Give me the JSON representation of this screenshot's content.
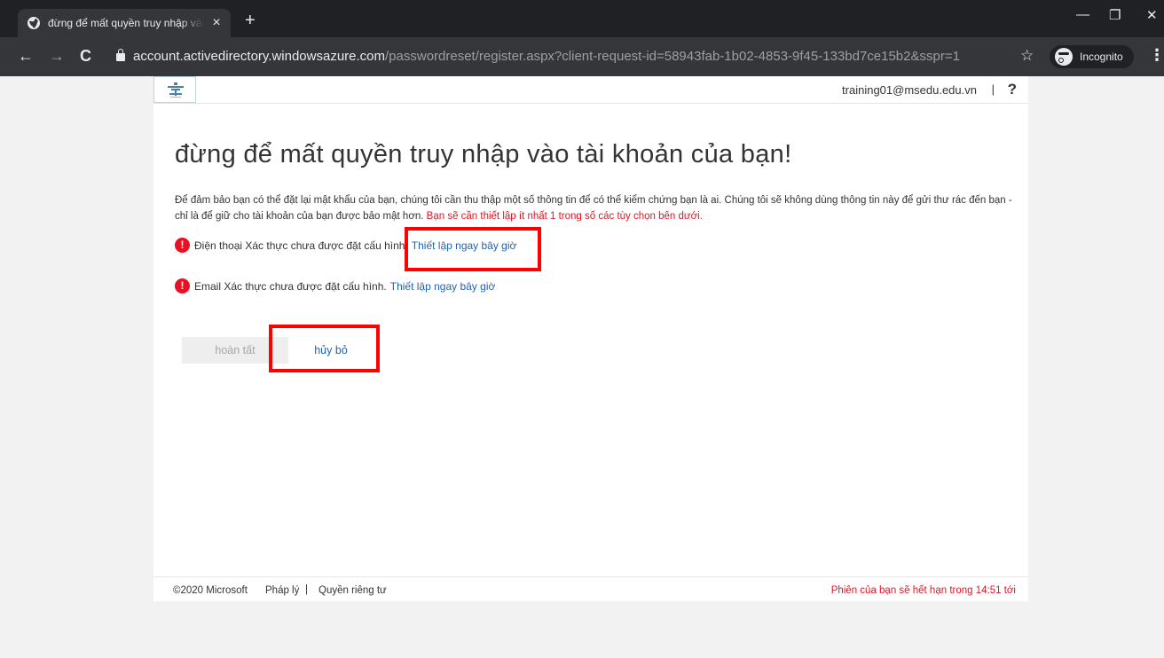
{
  "browser": {
    "tab_title": "đừng để mất quyền truy nhập vào tài khoản của bạn!",
    "tab_close_icon": "×",
    "new_tab_icon": "+",
    "window_controls": {
      "minimize": "—",
      "restore": "❐",
      "close": "✕"
    },
    "back_icon": "←",
    "forward_icon": "→",
    "reload_icon": "C",
    "url_host": "account.activedirectory.windowsazure.com",
    "url_path": "/passwordreset/register.aspx?client-request-id=58943fab-1b02-4853-9f45-133bd7ce15b2&sspr=1",
    "star_icon": "☆",
    "incognito_label": "Incognito",
    "menu_icon": "⋮"
  },
  "header": {
    "user_email": "training01@msedu.edu.vn",
    "separator": "|",
    "help": "?"
  },
  "main": {
    "title": "đừng để mất quyền truy nhập vào tài khoản của bạn!",
    "intro_text": "Để đảm bảo bạn có thể đặt lại mật khẩu của bạn, chúng tôi cần thu thập một số thông tin để có thể kiểm chứng bạn là ai. Chúng tôi sẽ không dùng thông tin này để gửi thư rác đến bạn - chỉ là để giữ cho tài khoản của bạn được bảo mật hơn. ",
    "intro_warning": "Bạn sẽ cần thiết lập ít nhất 1 trong số các tùy chọn bên dưới.",
    "phone_status": "Điện thoại Xác thực chưa được đặt cấu hình.",
    "phone_link": "Thiết lập ngay bây giờ",
    "email_status": "Email Xác thực chưa được đặt cấu hình.",
    "email_link": "Thiết lập ngay bây giờ",
    "alert_glyph": "!",
    "done_button": "hoàn tất",
    "cancel_button": "hủy bỏ"
  },
  "footer": {
    "copyright": "©2020 Microsoft",
    "legal": "Pháp lý",
    "separator": "|",
    "privacy": "Quyền riêng tư",
    "session": "Phiên của bạn sẽ hết hạn trong 14:51 tới"
  },
  "colors": {
    "warning_red": "#e81123",
    "link_blue": "#2562b2",
    "highlight_red": "#ff0000"
  }
}
